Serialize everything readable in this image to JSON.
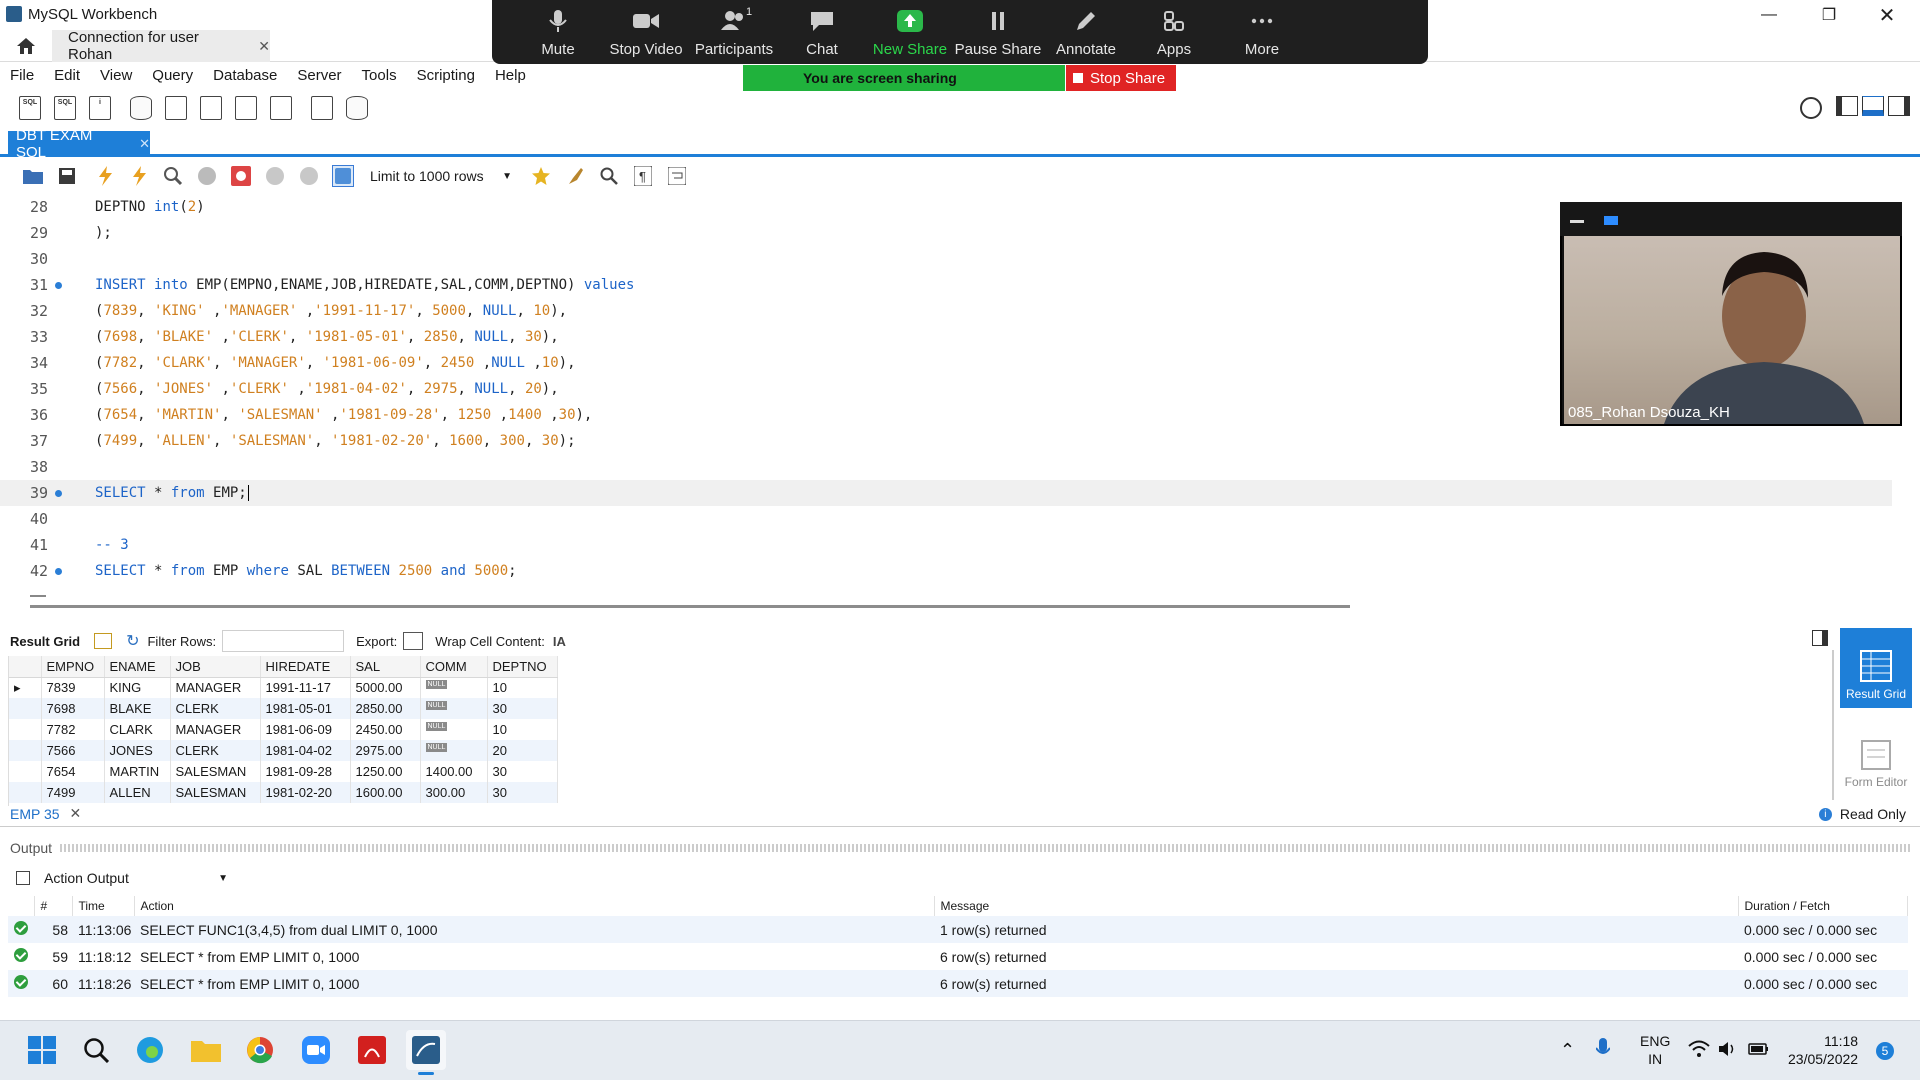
{
  "app": {
    "title": "MySQL Workbench",
    "conn_tab": "Connection for user Rohan"
  },
  "menu": [
    "File",
    "Edit",
    "View",
    "Query",
    "Database",
    "Server",
    "Tools",
    "Scripting",
    "Help"
  ],
  "zoom": {
    "items": [
      {
        "label": "Mute",
        "icon": "microphone-icon"
      },
      {
        "label": "Stop Video",
        "icon": "video-camera-icon"
      },
      {
        "label": "Participants",
        "icon": "participants-icon",
        "count": "1"
      },
      {
        "label": "Chat",
        "icon": "chat-icon"
      },
      {
        "label": "New Share",
        "icon": "share-up-icon"
      },
      {
        "label": "Pause Share",
        "icon": "pause-icon"
      },
      {
        "label": "Annotate",
        "icon": "pen-icon"
      },
      {
        "label": "Apps",
        "icon": "apps-icon"
      },
      {
        "label": "More",
        "icon": "more-icon"
      }
    ],
    "banner": "You are screen sharing",
    "stop": "Stop Share",
    "colors": {
      "bar": "#1f1f1f",
      "share": "#20b23c",
      "stop": "#e02424"
    }
  },
  "query_tab": "DBT EXAM SQL",
  "limit": "Limit to 1000 rows",
  "editor": {
    "lines": [
      {
        "n": "28",
        "dot": false,
        "text": "DEPTNO int(2)"
      },
      {
        "n": "29",
        "dot": false,
        "text": ");"
      },
      {
        "n": "30",
        "dot": false,
        "text": ""
      },
      {
        "n": "31",
        "dot": true,
        "text": "INSERT into EMP(EMPNO,ENAME,JOB,HIREDATE,SAL,COMM,DEPTNO) values"
      },
      {
        "n": "32",
        "dot": false,
        "text": "(7839, 'KING' ,'MANAGER' ,'1991-11-17', 5000, NULL, 10),"
      },
      {
        "n": "33",
        "dot": false,
        "text": "(7698, 'BLAKE' ,'CLERK', '1981-05-01', 2850, NULL, 30),"
      },
      {
        "n": "34",
        "dot": false,
        "text": "(7782, 'CLARK', 'MANAGER', '1981-06-09', 2450 ,NULL ,10),"
      },
      {
        "n": "35",
        "dot": false,
        "text": "(7566, 'JONES' ,'CLERK' ,'1981-04-02', 2975, NULL, 20),"
      },
      {
        "n": "36",
        "dot": false,
        "text": "(7654, 'MARTIN', 'SALESMAN' ,'1981-09-28', 1250 ,1400 ,30),"
      },
      {
        "n": "37",
        "dot": false,
        "text": "(7499, 'ALLEN', 'SALESMAN', '1981-02-20', 1600, 300, 30);"
      },
      {
        "n": "38",
        "dot": false,
        "text": ""
      },
      {
        "n": "39",
        "dot": true,
        "text": "SELECT * from EMP;"
      },
      {
        "n": "40",
        "dot": false,
        "text": ""
      },
      {
        "n": "41",
        "dot": false,
        "text": "-- 3"
      },
      {
        "n": "42",
        "dot": true,
        "text": "SELECT * from EMP where SAL BETWEEN 2500 and 5000;"
      }
    ]
  },
  "video": {
    "name": "085_Rohan Dsouza_KH"
  },
  "result": {
    "toolbar": {
      "grid": "Result Grid",
      "filter": "Filter Rows:",
      "export": "Export:",
      "wrap": "Wrap Cell Content:"
    },
    "columns": [
      "EMPNO",
      "ENAME",
      "JOB",
      "HIREDATE",
      "SAL",
      "COMM",
      "DEPTNO"
    ],
    "rows": [
      [
        "7839",
        "KING",
        "MANAGER",
        "1991-11-17",
        "5000.00",
        "NULL",
        "10"
      ],
      [
        "7698",
        "BLAKE",
        "CLERK",
        "1981-05-01",
        "2850.00",
        "NULL",
        "30"
      ],
      [
        "7782",
        "CLARK",
        "MANAGER",
        "1981-06-09",
        "2450.00",
        "NULL",
        "10"
      ],
      [
        "7566",
        "JONES",
        "CLERK",
        "1981-04-02",
        "2975.00",
        "NULL",
        "20"
      ],
      [
        "7654",
        "MARTIN",
        "SALESMAN",
        "1981-09-28",
        "1250.00",
        "1400.00",
        "30"
      ],
      [
        "7499",
        "ALLEN",
        "SALESMAN",
        "1981-02-20",
        "1600.00",
        "300.00",
        "30"
      ]
    ],
    "side": {
      "grid": "Result Grid",
      "form": "Form Editor"
    },
    "tab": "EMP 35",
    "readonly": "Read Only"
  },
  "output": {
    "title": "Output",
    "selector": "Action Output",
    "columns": [
      "#",
      "Time",
      "Action",
      "Message",
      "Duration / Fetch"
    ],
    "rows": [
      [
        "58",
        "11:13:06",
        "SELECT FUNC1(3,4,5) from dual LIMIT 0, 1000",
        "1 row(s) returned",
        "0.000 sec / 0.000 sec"
      ],
      [
        "59",
        "11:18:12",
        "SELECT * from EMP LIMIT 0, 1000",
        "6 row(s) returned",
        "0.000 sec / 0.000 sec"
      ],
      [
        "60",
        "11:18:26",
        "SELECT * from EMP LIMIT 0, 1000",
        "6 row(s) returned",
        "0.000 sec / 0.000 sec"
      ]
    ]
  },
  "taskbar": {
    "lang1": "ENG",
    "lang2": "IN",
    "time": "11:18",
    "date": "23/05/2022",
    "badge": "5"
  }
}
